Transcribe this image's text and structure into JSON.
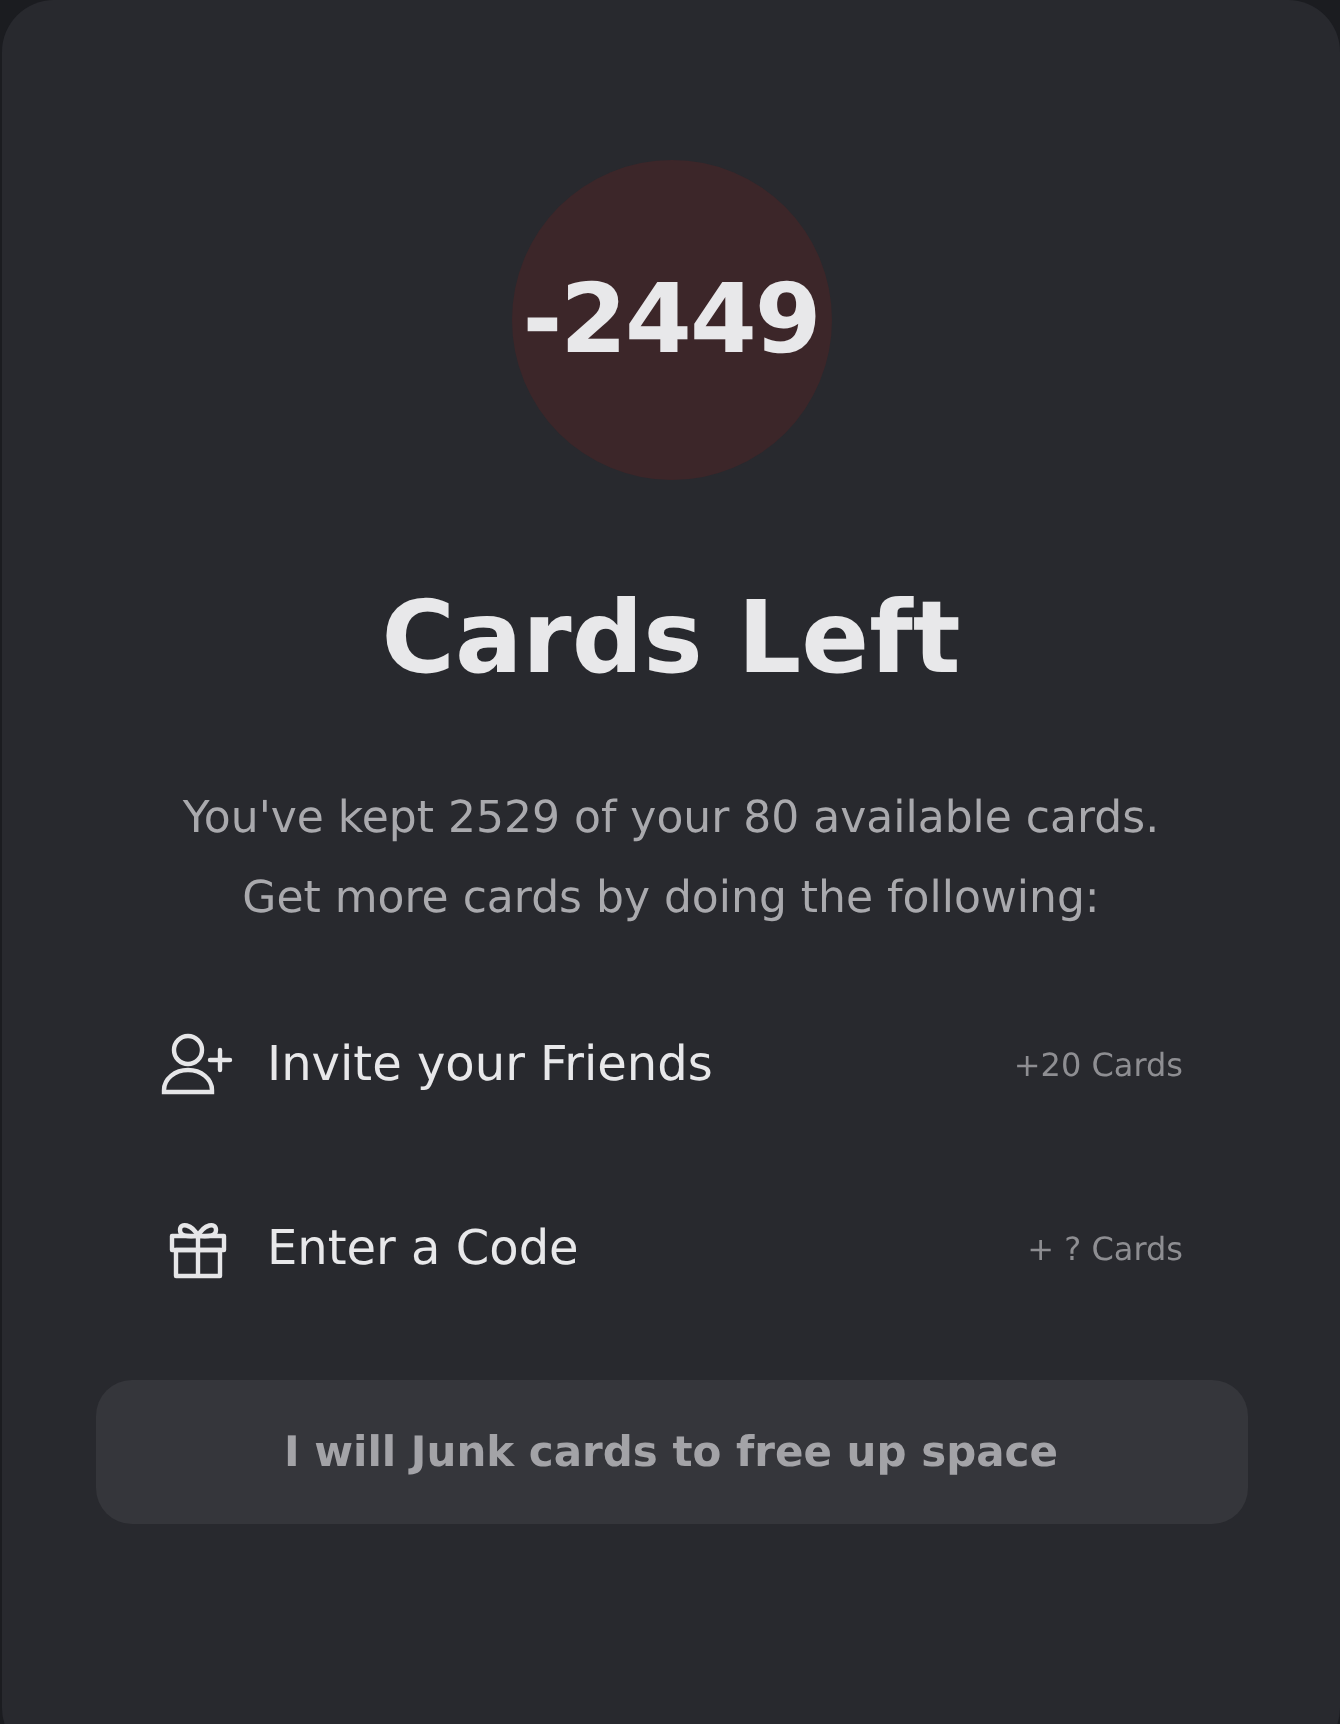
{
  "counter": "-2449",
  "title": "Cards Left",
  "description": "You've kept 2529 of your 80 available cards. Get more cards by doing the following:",
  "options": [
    {
      "kind": "invite",
      "label": "Invite your Friends",
      "reward": "+20 Cards"
    },
    {
      "kind": "code",
      "label": "Enter a Code",
      "reward": "+ ? Cards"
    }
  ],
  "button": "I will Junk cards to free up space"
}
